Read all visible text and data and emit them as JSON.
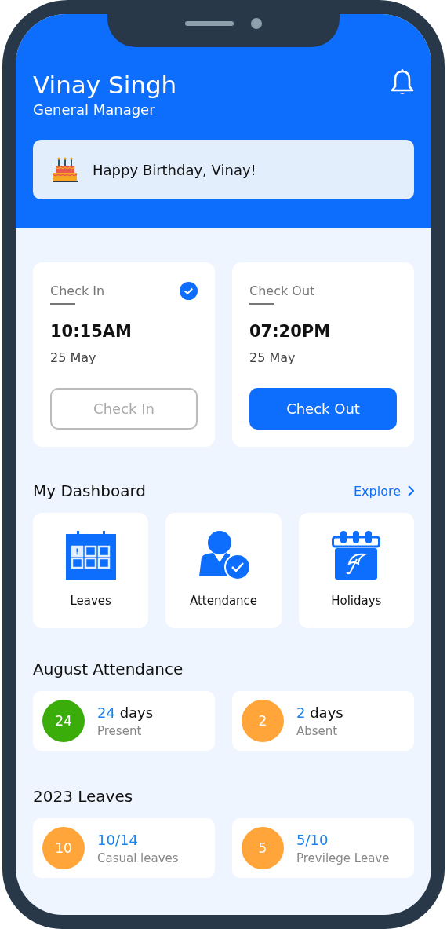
{
  "header": {
    "name": "Vinay Singh",
    "role": "General Manager",
    "notification": {
      "kind": "bell"
    },
    "banner": {
      "text": "Happy Birthday, Vinay!"
    }
  },
  "punch_cards": [
    {
      "label": "Check In",
      "checked": true,
      "time": "10:15AM",
      "date": "25 May",
      "button": {
        "label": "Check In",
        "disabled": true
      }
    },
    {
      "label": "Check Out",
      "checked": false,
      "time": "07:20PM",
      "date": "25 May",
      "button": {
        "label": "Check Out",
        "disabled": false
      }
    }
  ],
  "dashboard": {
    "title": "My Dashboard",
    "link": "Explore",
    "tiles": [
      {
        "kind": "leaves",
        "label": "Leaves"
      },
      {
        "kind": "attendance",
        "label": "Attendance"
      },
      {
        "kind": "holidays",
        "label": "Holidays"
      }
    ]
  },
  "attendance": {
    "title": "August Attendance",
    "stats": [
      {
        "count": "24",
        "value": "24",
        "unit": "days",
        "label": "Present",
        "color": "#3aad0a"
      },
      {
        "count": "2",
        "value": "2",
        "unit": "days",
        "label": "Absent",
        "color": "#ffa53a"
      }
    ]
  },
  "leaves": {
    "title": "2023 Leaves",
    "stats": [
      {
        "count": "10",
        "value": "10/14",
        "label": "Casual leaves",
        "color": "#ffa53a"
      },
      {
        "count": "5",
        "value": "5/10",
        "label": "Previlege Leave",
        "color": "#ffa53a"
      }
    ]
  }
}
